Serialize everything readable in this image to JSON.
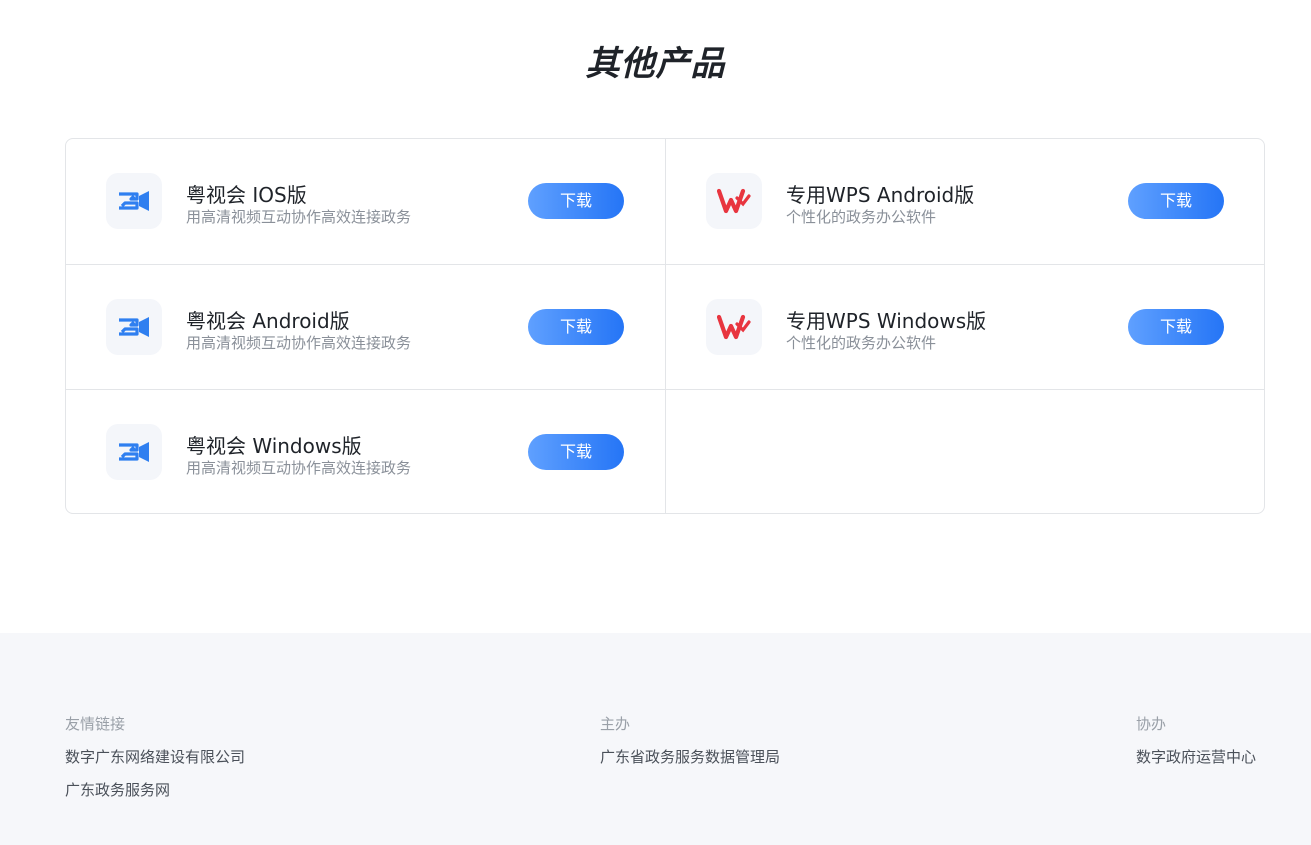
{
  "section": {
    "title": "其他产品"
  },
  "products": [
    {
      "name": "粤视会 IOS版",
      "desc": "用高清视频互动协作高效连接政务",
      "icon": "video-conference-icon",
      "button": "下载"
    },
    {
      "name": "专用WPS Android版",
      "desc": "个性化的政务办公软件",
      "icon": "wps-icon",
      "button": "下载"
    },
    {
      "name": "粤视会 Android版",
      "desc": "用高清视频互动协作高效连接政务",
      "icon": "video-conference-icon",
      "button": "下载"
    },
    {
      "name": "专用WPS Windows版",
      "desc": "个性化的政务办公软件",
      "icon": "wps-icon",
      "button": "下载"
    },
    {
      "name": "粤视会 Windows版",
      "desc": "用高清视频互动协作高效连接政务",
      "icon": "video-conference-icon",
      "button": "下载"
    }
  ],
  "footer": {
    "friends": {
      "heading": "友情链接",
      "links": [
        "数字广东网络建设有限公司",
        "广东政务服务网"
      ]
    },
    "host": {
      "heading": "主办",
      "links": [
        "广东省政务服务数据管理局"
      ]
    },
    "co": {
      "heading": "协办",
      "links": [
        "数字政府运营中心"
      ]
    }
  },
  "colors": {
    "accent": "#2575f6",
    "video_icon": "#2f7ff0",
    "wps_icon": "#e8353f",
    "footer_bg": "#f6f7fa"
  }
}
